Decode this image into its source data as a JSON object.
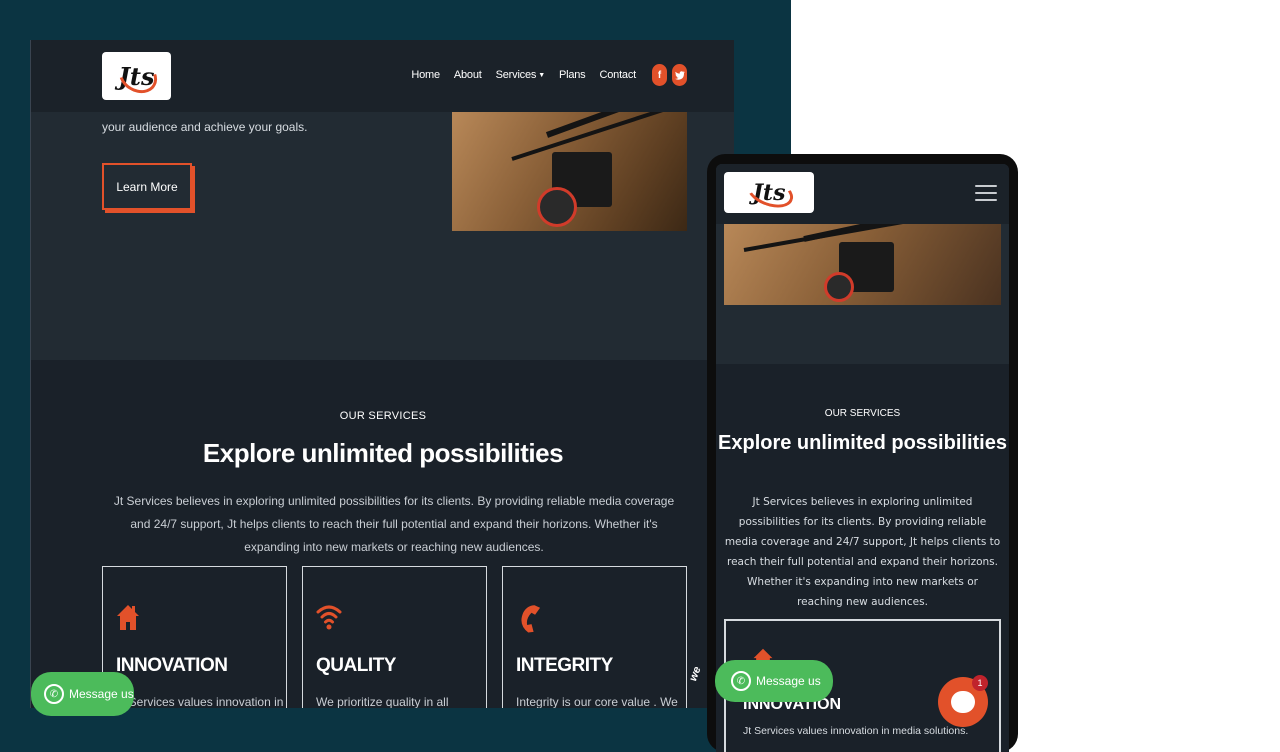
{
  "colors": {
    "accent": "#e2512a",
    "page_bg": "#0b3442",
    "site_bg": "#1a2129",
    "whatsapp": "#4cbb5b"
  },
  "desktop": {
    "logo_text": "Jts",
    "nav": {
      "home": "Home",
      "about": "About",
      "services": "Services",
      "plans": "Plans",
      "contact": "Contact",
      "facebook_icon": "f",
      "twitter_icon": "t"
    },
    "hero": {
      "text": "your audience and achieve your goals.",
      "button": "Learn More"
    },
    "services": {
      "label": "OUR SERVICES",
      "title": "Explore unlimited possibilities",
      "description": "Jt Services believes in exploring unlimited possibilities for its clients. By providing reliable media coverage and 24/7 support, Jt helps clients to reach their full potential and expand their horizons. Whether it's expanding into new markets or reaching new audiences.",
      "cards": [
        {
          "icon": "home-icon",
          "title": "INNOVATION",
          "text": "Jt Services values innovation in"
        },
        {
          "icon": "wifi-icon",
          "title": "QUALITY",
          "text": "We prioritize quality in all aspects"
        },
        {
          "icon": "phone-icon",
          "title": "INTEGRITY",
          "text": "Integrity is our core value . We"
        }
      ]
    },
    "whatsapp": "Message us"
  },
  "mobile": {
    "logo_text": "Jts",
    "services": {
      "label": "OUR SERVICES",
      "title": "Explore unlimited possibilities",
      "description": "Jt Services believes in exploring unlimited possibilities for its clients. By providing reliable media coverage and 24/7 support, Jt helps clients to reach their full potential and expand their horizons. Whether it's expanding into new markets or reaching new audiences.",
      "card_title": "INNOVATION",
      "card_text": "Jt Services values innovation in media solutions."
    },
    "whatsapp": "Message us",
    "chat_badge": "1"
  }
}
